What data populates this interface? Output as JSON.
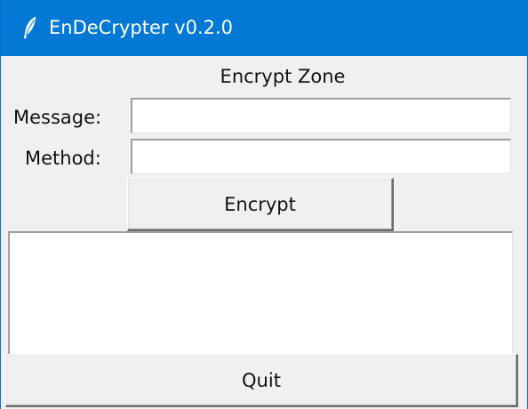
{
  "window": {
    "title": "EnDeCrypter v0.2.0",
    "icon": "feather-icon",
    "titlebar_color": "#0078d4"
  },
  "encrypt_zone": {
    "heading": "Encrypt Zone",
    "message_label": "Message:",
    "message_value": "",
    "method_label": "Method:",
    "method_value": "",
    "encrypt_button": "Encrypt",
    "output_value": ""
  },
  "footer": {
    "quit_button": "Quit"
  }
}
